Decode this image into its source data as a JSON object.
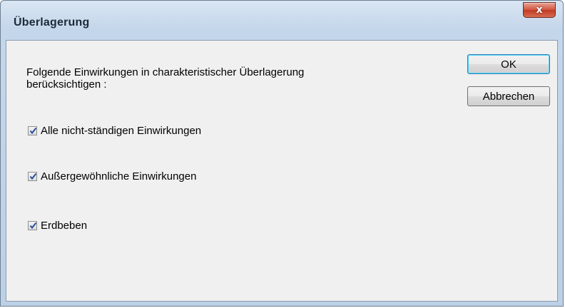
{
  "window": {
    "title": "Überlagerung",
    "close_glyph": "x"
  },
  "dialog": {
    "description": "Folgende Einwirkungen in charakteristischer Überlagerung\nberücksichtigen :",
    "ok_label": "OK",
    "cancel_label": "Abbrechen",
    "options": [
      {
        "label": "Alle nicht-ständigen Einwirkungen",
        "checked": true
      },
      {
        "label": "Außergewöhnliche Einwirkungen",
        "checked": true
      },
      {
        "label": "Erdbeben",
        "checked": true
      }
    ]
  },
  "colors": {
    "title_bar": "#c4d6ea",
    "client": "#f0f0f0",
    "close_button": "#c03a23",
    "check_mark": "#2b4f9c"
  }
}
